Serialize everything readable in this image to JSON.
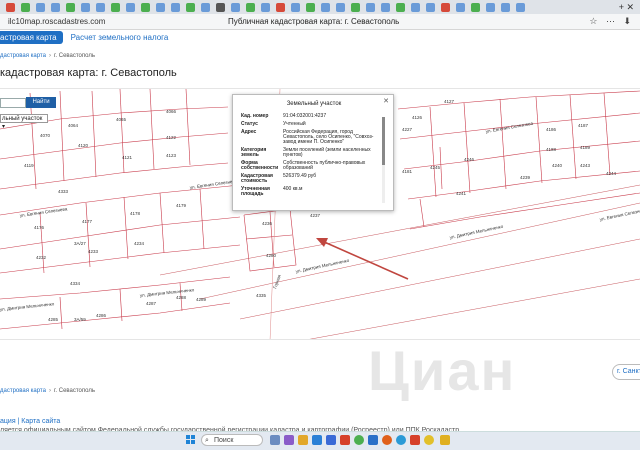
{
  "browser": {
    "url": "ilc10map.roscadastres.com",
    "page_title": "Публичная кадастровая карта: г. Севастополь"
  },
  "nav": {
    "active": "астровая карта",
    "link": "Расчет земельного налога"
  },
  "breadcrumb_top": {
    "parent": "дастровая карта",
    "current": "г. Севастополь"
  },
  "page_heading": "кадастровая карта: г. Севастополь",
  "map": {
    "find_button": "Найти",
    "layer_select": "льный участок",
    "parcels": [
      "4066",
      "4063",
      "4064",
      "4065",
      "4070",
      "4120",
      "4121",
      "4122",
      "4123",
      "4119",
      "4333",
      "4177",
      "4176",
      "4178",
      "4179",
      "4234",
      "4232",
      "4233",
      "4236",
      "4237",
      "4280",
      "4227",
      "4186",
      "4187",
      "4188",
      "4189",
      "4241",
      "4240",
      "4239",
      "4243",
      "4244",
      "4181",
      "4245",
      "4246",
      "4127",
      "4126",
      "4285",
      "4286",
      "4287",
      "4288",
      "4289",
      "4335",
      "4334",
      "3А/27",
      "3А/59"
    ],
    "streets": [
      "ул. Евгения Селезнева",
      "ул. Евгения Селезнева",
      "ул. Евгения Селезнева",
      "ул. Евгения Селезнева",
      "ул. Дмитрия Мельниченко",
      "ул. Дмитрия Мельниченко",
      "ул. Дмитрия Мельниченко",
      "ул. Дмитрия Мельниченко",
      "Горная"
    ]
  },
  "popup": {
    "title": "Земельный участок",
    "rows": [
      {
        "k": "Кад. номер",
        "v": "91:04:032001:4237"
      },
      {
        "k": "Статус",
        "v": "Учтенный"
      },
      {
        "k": "Адрес",
        "v": "Российская Федерация, город Севастополь, село Осипенко, \"Совхоз-завод имени П. Осипенко\""
      },
      {
        "k": "Категория земель",
        "v": "Земли поселений (земли населенных пунктов)"
      },
      {
        "k": "Форма собственности",
        "v": "Собственность публично-правовых образований"
      },
      {
        "k": "Кадастровая стоимость",
        "v": "526379.49 руб"
      },
      {
        "k": "Уточненная площадь",
        "v": "400 кв.м"
      }
    ]
  },
  "breadcrumb_bottom": {
    "parent": "дастровая карта",
    "current": "г. Севастополь"
  },
  "city_button": "г. Санкт",
  "watermark": "Циан",
  "footer": {
    "links": "ация | Карта сайта",
    "text": "ляется официальным сайтом Федеральной службы государственной регистрации кадастра и картографии (Росреестр) или ППК Роскадастр"
  },
  "taskbar": {
    "search_placeholder": "Поиск"
  },
  "colors": {
    "accent": "#1f6fc4",
    "parcel_line": "#c83a4a",
    "arrow": "#c0463f"
  }
}
